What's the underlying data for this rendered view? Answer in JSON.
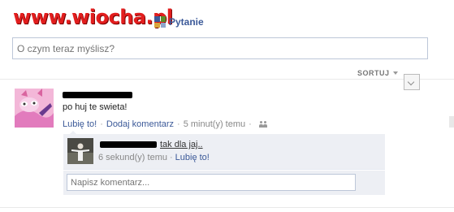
{
  "watermark": {
    "text": "www.wiocha.pl"
  },
  "composer": {
    "pytanie_label": "Pytanie",
    "status_placeholder": "O czym teraz myślisz?"
  },
  "feed": {
    "sort_label": "SORTUJ"
  },
  "post": {
    "text": "po huj te swieta!",
    "like_label": "Lubię to!",
    "comment_label": "Dodaj komentarz",
    "timestamp": "5 minut(y) temu"
  },
  "comment": {
    "text": "tak dla jaj..",
    "timestamp": "6 sekund(y) temu",
    "like_label": "Lubię to!"
  },
  "comment_input": {
    "placeholder": "Napisz komentarz..."
  },
  "colors": {
    "link": "#3b5998",
    "comment_bg": "#edeff4",
    "watermark": "#e21e1e"
  }
}
